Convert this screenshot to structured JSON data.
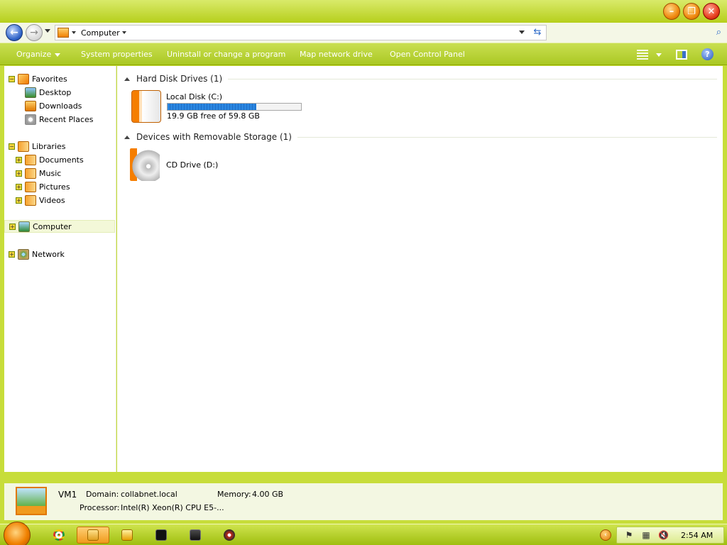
{
  "address": {
    "path": "Computer"
  },
  "toolbar": {
    "organize": "Organize",
    "system_properties": "System properties",
    "uninstall": "Uninstall or change a program",
    "map_drive": "Map network drive",
    "control_panel": "Open Control Panel"
  },
  "nav": {
    "favorites": "Favorites",
    "desktop": "Desktop",
    "downloads": "Downloads",
    "recent": "Recent Places",
    "libraries": "Libraries",
    "documents": "Documents",
    "music": "Music",
    "pictures": "Pictures",
    "videos": "Videos",
    "computer": "Computer",
    "network": "Network"
  },
  "content": {
    "hdd_group": "Hard Disk Drives (1)",
    "removable_group": "Devices with Removable Storage (1)",
    "local_disk": {
      "name": "Local Disk (C:)",
      "space": "19.9 GB free of 59.8 GB",
      "used_fraction": 0.667
    },
    "cd_drive": {
      "name": "CD Drive (D:)"
    }
  },
  "details": {
    "name": "VM1",
    "domain_label": "Domain:",
    "domain": "collabnet.local",
    "memory_label": "Memory:",
    "memory": "4.00 GB",
    "processor_label": "Processor:",
    "processor": "Intel(R) Xeon(R) CPU E5-..."
  },
  "taskbar": {
    "clock": "2:54 AM"
  },
  "colors": {
    "accent": "#b5cf1e",
    "window_min": "#f08a10",
    "window_close": "#e84020",
    "progress": "#2a86e0"
  }
}
